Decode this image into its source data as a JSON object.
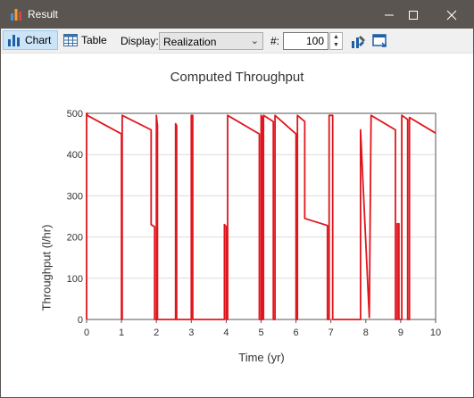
{
  "window": {
    "title": "Result",
    "icon": "bar-chart-icon",
    "controls": [
      "minimize",
      "maximize",
      "close"
    ]
  },
  "toolbar": {
    "chart_label": "Chart",
    "table_label": "Table",
    "display_label": "Display:",
    "display_value": "Realization",
    "number_label": "#:",
    "number_value": "100"
  },
  "colors": {
    "titlebar": "#5a5550",
    "series": "#e0161e",
    "active_tab": "#cce4f7"
  },
  "chart_data": {
    "type": "line",
    "title": "Computed Throughput",
    "xlabel": "Time (yr)",
    "ylabel": "Throughput (l/hr)",
    "xlim": [
      0,
      10
    ],
    "ylim": [
      0,
      500
    ],
    "xticks": [
      0,
      1,
      2,
      3,
      4,
      5,
      6,
      7,
      8,
      9,
      10
    ],
    "yticks": [
      0,
      100,
      200,
      300,
      400,
      500
    ],
    "grid": "horizontal",
    "series": [
      {
        "color": "#e0161e",
        "x": [
          0,
          0,
          0.02,
          0.02,
          1.0,
          1.0,
          1.02,
          1.02,
          1.85,
          1.85,
          1.95,
          1.95,
          2.0,
          2.0,
          2.03,
          2.03,
          2.55,
          2.55,
          2.58,
          2.58,
          3.0,
          3.0,
          3.04,
          3.04,
          3.95,
          3.95,
          4.0,
          4.0,
          4.04,
          4.04,
          4.95,
          4.95,
          5.0,
          5.0,
          5.03,
          5.03,
          5.07,
          5.07,
          5.35,
          5.35,
          5.4,
          5.4,
          6.0,
          6.0,
          6.04,
          6.04,
          6.25,
          6.25,
          6.9,
          6.9,
          6.95,
          6.95,
          7.05,
          7.05,
          7.85,
          7.85,
          8.1,
          8.1,
          8.15,
          8.15,
          8.85,
          8.85,
          8.9,
          8.9,
          8.95,
          8.95,
          9.03,
          9.03,
          9.2,
          9.2,
          9.25,
          9.25,
          10.0
        ],
        "y": [
          0,
          500,
          500,
          495,
          450,
          0,
          0,
          495,
          460,
          230,
          225,
          0,
          0,
          495,
          470,
          0,
          0,
          475,
          470,
          0,
          0,
          495,
          495,
          0,
          0,
          230,
          225,
          0,
          0,
          495,
          450,
          0,
          0,
          495,
          490,
          0,
          0,
          495,
          480,
          0,
          0,
          495,
          450,
          0,
          0,
          495,
          480,
          245,
          228,
          0,
          0,
          495,
          495,
          0,
          0,
          460,
          5,
          5,
          495,
          495,
          460,
          0,
          0,
          232,
          232,
          0,
          0,
          495,
          485,
          0,
          0,
          490,
          452
        ]
      }
    ]
  }
}
